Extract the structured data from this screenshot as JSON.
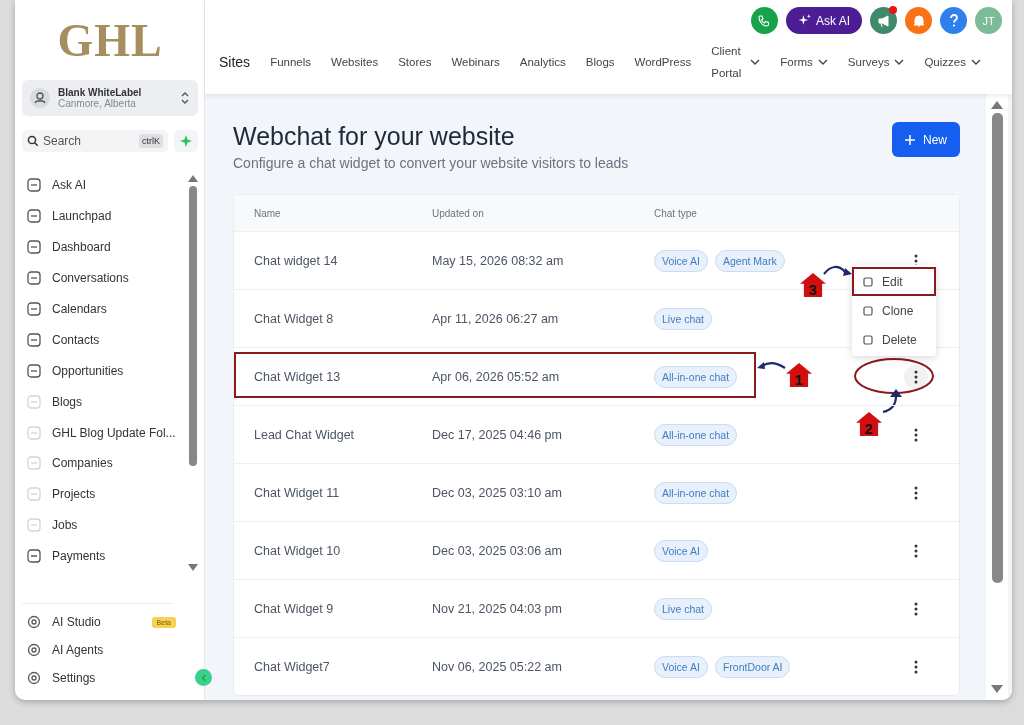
{
  "sidebar": {
    "logo": "GHL",
    "account": {
      "name": "Blank WhiteLabel",
      "location": "Canmore, Alberta"
    },
    "search": {
      "placeholder": "Search",
      "shortcut": "ctrlK"
    },
    "items": [
      {
        "label": "Ask AI",
        "faded_icon": false
      },
      {
        "label": "Launchpad",
        "faded_icon": false
      },
      {
        "label": "Dashboard",
        "faded_icon": false
      },
      {
        "label": "Conversations",
        "faded_icon": false
      },
      {
        "label": "Calendars",
        "faded_icon": false
      },
      {
        "label": "Contacts",
        "faded_icon": false
      },
      {
        "label": "Opportunities",
        "faded_icon": false
      },
      {
        "label": "Blogs",
        "faded_icon": true
      },
      {
        "label": "GHL Blog Update Fol...",
        "faded_icon": true
      },
      {
        "label": "Companies",
        "faded_icon": true
      },
      {
        "label": "Projects",
        "faded_icon": true
      },
      {
        "label": "Jobs",
        "faded_icon": true
      },
      {
        "label": "Payments",
        "faded_icon": false
      }
    ],
    "bottom_items": [
      {
        "label": "AI Studio",
        "badge": "Beta"
      },
      {
        "label": "AI Agents"
      },
      {
        "label": "Settings"
      }
    ]
  },
  "header": {
    "ask_ai": "Ask AI",
    "avatar": "JT",
    "notification_dot": true,
    "section": "Sites",
    "tabs": [
      {
        "label": "Funnels",
        "dropdown": false
      },
      {
        "label": "Websites",
        "dropdown": false
      },
      {
        "label": "Stores",
        "dropdown": false
      },
      {
        "label": "Webinars",
        "dropdown": false
      },
      {
        "label": "Analytics",
        "dropdown": false
      },
      {
        "label": "Blogs",
        "dropdown": false
      },
      {
        "label": "WordPress",
        "dropdown": false
      },
      {
        "label": "Client Portal",
        "dropdown": true
      },
      {
        "label": "Forms",
        "dropdown": true
      },
      {
        "label": "Surveys",
        "dropdown": true
      },
      {
        "label": "Quizzes",
        "dropdown": true
      }
    ]
  },
  "page": {
    "title": "Webchat for your website",
    "subtitle": "Configure a chat widget to convert your website visitors to leads",
    "new_button": "New"
  },
  "table": {
    "columns": [
      "Name",
      "Updated on",
      "Chat type"
    ],
    "rows": [
      {
        "name": "Chat widget 14",
        "updated": "May 15, 2026 08:32 am",
        "types": [
          "Voice AI",
          "Agent Mark"
        ],
        "highlighted": false,
        "actions_circled": false
      },
      {
        "name": "Chat Widget 8",
        "updated": "Apr 11, 2026 06:27 am",
        "types": [
          "Live chat"
        ],
        "highlighted": false
      },
      {
        "name": "Chat Widget 13",
        "updated": "Apr 06, 2026 05:52 am",
        "types": [
          "All-in-one chat"
        ],
        "highlighted": true,
        "actions_circled": true
      },
      {
        "name": "Lead Chat Widget",
        "updated": "Dec 17, 2025 04:46 pm",
        "types": [
          "All-in-one chat"
        ],
        "highlighted": false,
        "actions_circled": false
      },
      {
        "name": "Chat Widget 11",
        "updated": "Dec 03, 2025 03:10 am",
        "types": [
          "All-in-one chat"
        ],
        "highlighted": false,
        "actions_circled": false
      },
      {
        "name": "Chat Widget 10",
        "updated": "Dec 03, 2025 03:06 am",
        "types": [
          "Voice AI"
        ],
        "highlighted": false,
        "actions_circled": false
      },
      {
        "name": "Chat Widget 9",
        "updated": "Nov 21, 2025 04:03 pm",
        "types": [
          "Live chat"
        ],
        "highlighted": false,
        "actions_circled": false
      },
      {
        "name": "Chat Widget7",
        "updated": "Nov 06, 2025 05:22 am",
        "types": [
          "Voice AI",
          "FrontDoor AI"
        ],
        "highlighted": false,
        "actions_circled": false
      }
    ],
    "menu": [
      {
        "label": "Edit",
        "highlighted": true
      },
      {
        "label": "Clone",
        "highlighted": false
      },
      {
        "label": "Delete",
        "highlighted": false
      }
    ]
  },
  "markers": [
    "1",
    "2",
    "3"
  ]
}
